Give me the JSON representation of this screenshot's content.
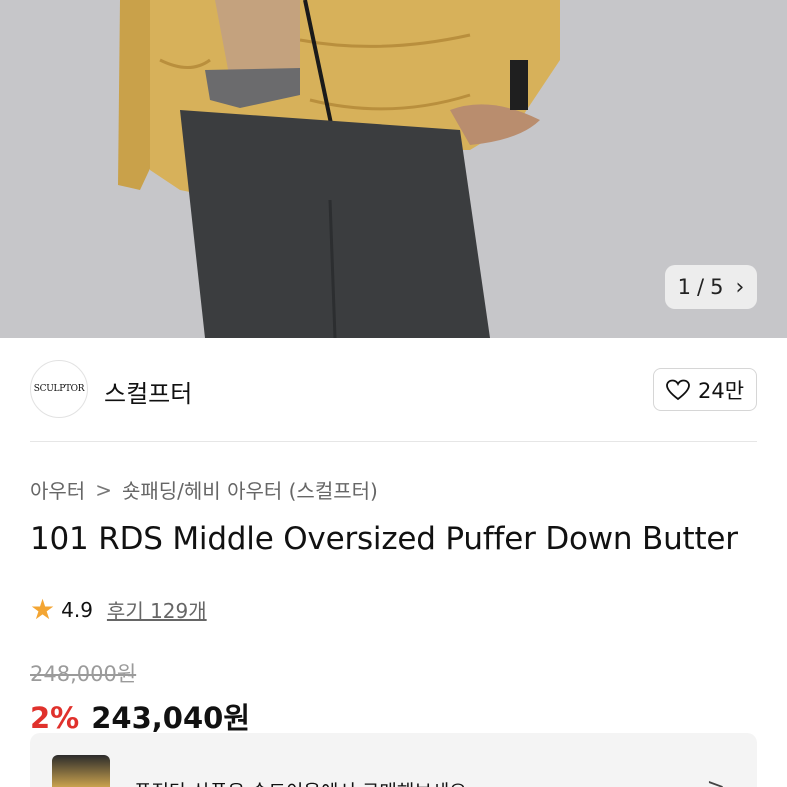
{
  "gallery": {
    "current": "1",
    "total": "5",
    "separator": "/",
    "next_icon": "chevron-right-icon"
  },
  "brand": {
    "logo_text": "SCULPTOR",
    "name": "스컬프터"
  },
  "like": {
    "icon": "heart-outline-icon",
    "count": "24만"
  },
  "breadcrumb": {
    "items": [
      "아우터",
      "숏패딩/헤비 아우터 (스컬프터)"
    ],
    "separator": ">"
  },
  "product": {
    "title": "101 RDS Middle Oversized Puffer Down Butter"
  },
  "rating": {
    "score": "4.9",
    "reviews": "후기 129개",
    "star_color": "#f3a533"
  },
  "price": {
    "original": "248,000원",
    "discount": "2%",
    "final": "243,040원",
    "discount_color": "#e0312c"
  },
  "promo": {
    "text": "푸적단 상품은 숏드이음에서 구매해보세요",
    "chevron": ">"
  }
}
